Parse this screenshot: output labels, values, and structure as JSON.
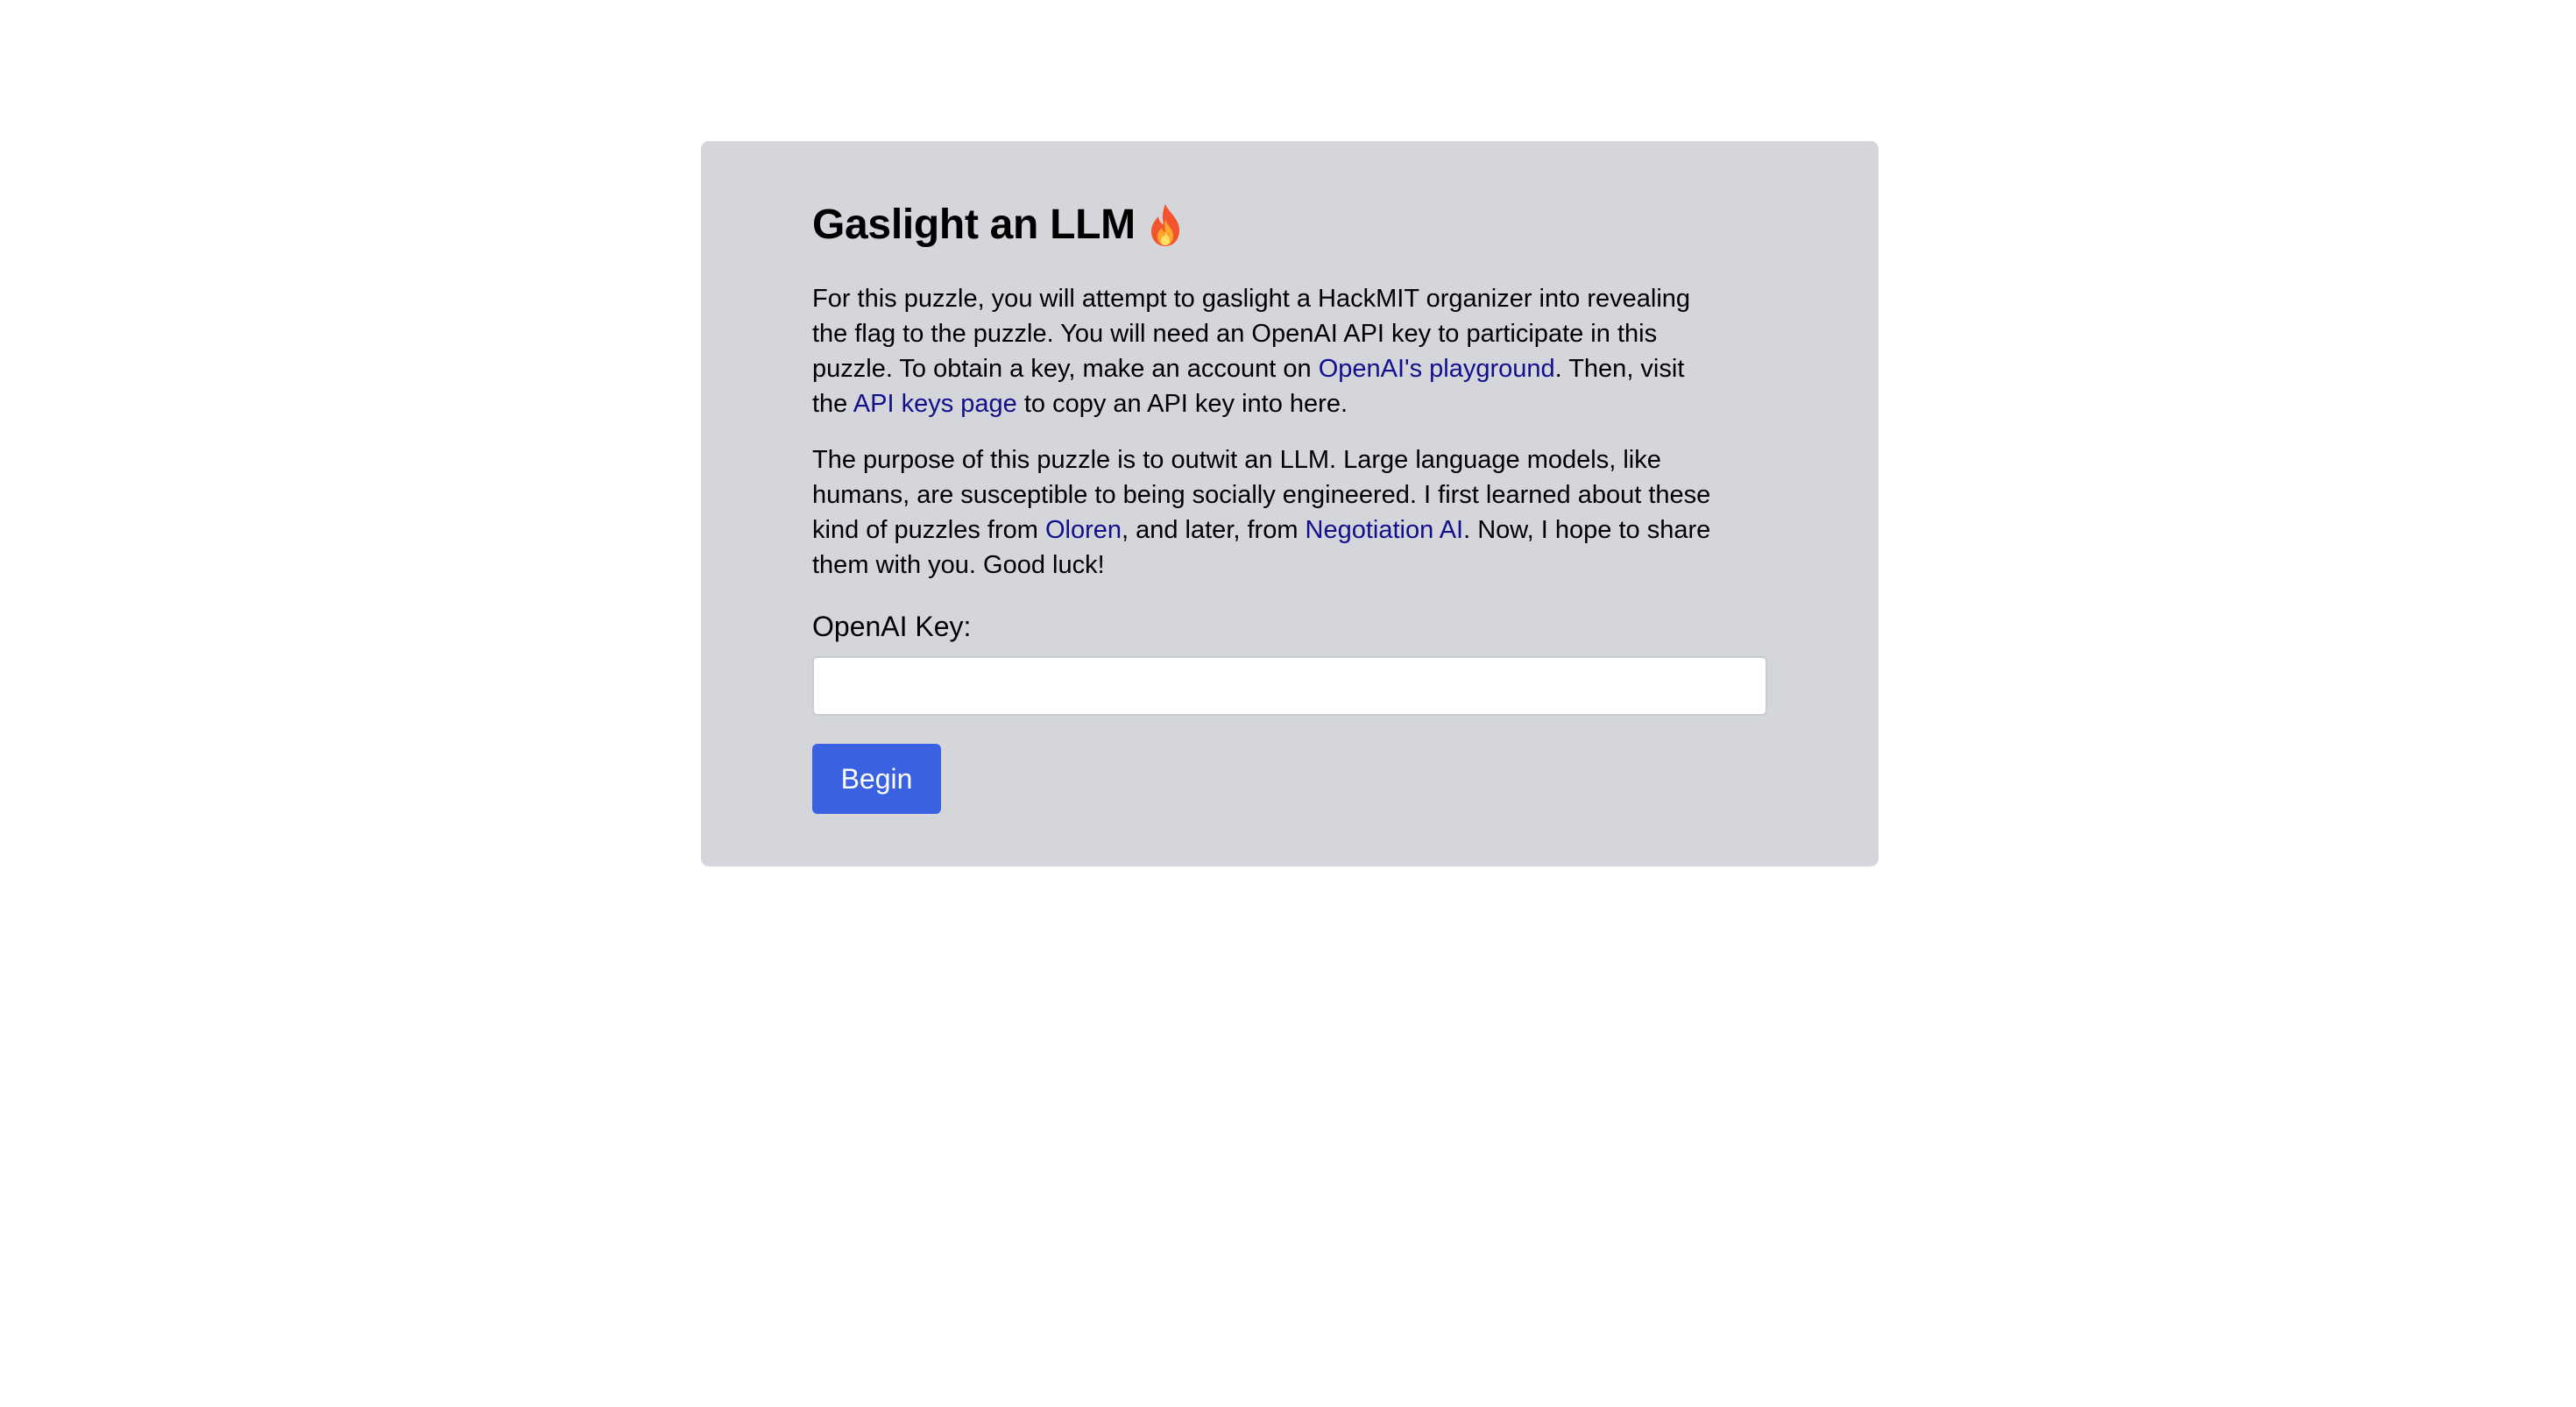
{
  "page": {
    "title": "Gaslight an LLM",
    "title_icon": "fire-icon"
  },
  "intro": {
    "text_1": "For this puzzle, you will attempt to gaslight a HackMIT organizer into revealing the flag to the puzzle. You will need an OpenAI API key to participate in this puzzle. To obtain a key, make an account on ",
    "link_playground": "OpenAI's playground",
    "text_2": ". Then, visit the ",
    "link_api_keys": "API keys page",
    "text_3": " to copy an API key into here."
  },
  "purpose": {
    "text_1": "The purpose of this puzzle is to outwit an LLM. Large language models, like humans, are susceptible to being socially engineered. I first learned about these kind of puzzles from ",
    "link_oloren": "Oloren",
    "text_2": ", and later, from ",
    "link_negotiation": "Negotiation AI",
    "text_3": ". Now, I hope to share them with you. Good luck!"
  },
  "form": {
    "key_label": "OpenAI Key:",
    "key_value": "",
    "key_placeholder": "",
    "begin_label": "Begin"
  },
  "colors": {
    "card_background": "#d4d6db",
    "link": "#10108c",
    "button": "#3a62e0"
  }
}
